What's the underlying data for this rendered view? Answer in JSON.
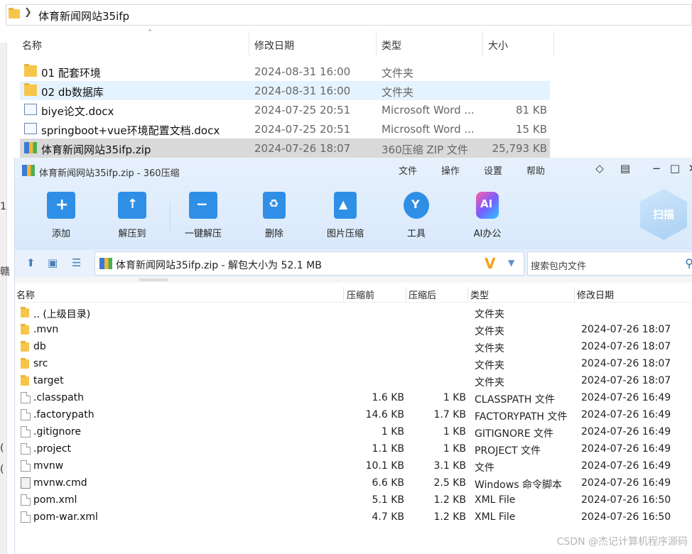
{
  "explorer": {
    "breadcrumb": "体育新闻网站35ifp",
    "columns": {
      "name": "名称",
      "modified": "修改日期",
      "type": "类型",
      "size": "大小"
    },
    "left_marks": [
      "1",
      "赣",
      "(",
      "("
    ],
    "rows": [
      {
        "name": "01 配套环境",
        "modified": "2024-08-31 16:00",
        "type": "文件夹",
        "size": "",
        "icon": "folder-icon"
      },
      {
        "name": "02 db数据库",
        "modified": "2024-08-31 16:00",
        "type": "文件夹",
        "size": "",
        "icon": "folder-icon"
      },
      {
        "name": "biye论文.docx",
        "modified": "2024-07-25 20:51",
        "type": "Microsoft Word ...",
        "size": "81 KB",
        "icon": "word-doc-icon"
      },
      {
        "name": "springboot+vue环境配置文档.docx",
        "modified": "2024-07-25 20:51",
        "type": "Microsoft Word ...",
        "size": "15 KB",
        "icon": "word-doc-icon"
      },
      {
        "name": "体育新闻网站35ifp.zip",
        "modified": "2024-07-26 18:07",
        "type": "360压缩 ZIP 文件",
        "size": "25,793 KB",
        "icon": "zip-archive-icon"
      }
    ]
  },
  "zip": {
    "window_title": "体育新闻网站35ifp.zip - 360压缩",
    "menu": [
      "文件",
      "操作",
      "设置",
      "帮助"
    ],
    "toolbar": [
      "添加",
      "解压到",
      "一键解压",
      "删除",
      "图片压缩",
      "工具",
      "AI办公"
    ],
    "scan_label": "扫描",
    "path": "体育新闻网站35ifp.zip - 解包大小为 52.1 MB",
    "search_placeholder": "搜索包内文件",
    "columns": {
      "name": "名称",
      "compressed_before": "压缩前",
      "compressed_after": "压缩后",
      "type": "类型",
      "modified": "修改日期"
    },
    "rows": [
      {
        "name": ".. (上级目录)",
        "before": "",
        "after": "",
        "type": "文件夹",
        "modified": "",
        "icon": "folder-icon"
      },
      {
        "name": ".mvn",
        "before": "",
        "after": "",
        "type": "文件夹",
        "modified": "2024-07-26 18:07",
        "icon": "folder-icon"
      },
      {
        "name": "db",
        "before": "",
        "after": "",
        "type": "文件夹",
        "modified": "2024-07-26 18:07",
        "icon": "folder-icon"
      },
      {
        "name": "src",
        "before": "",
        "after": "",
        "type": "文件夹",
        "modified": "2024-07-26 18:07",
        "icon": "folder-icon"
      },
      {
        "name": "target",
        "before": "",
        "after": "",
        "type": "文件夹",
        "modified": "2024-07-26 18:07",
        "icon": "folder-icon"
      },
      {
        "name": ".classpath",
        "before": "1.6 KB",
        "after": "1 KB",
        "type": "CLASSPATH 文件",
        "modified": "2024-07-26 16:49",
        "icon": "file-icon"
      },
      {
        "name": ".factorypath",
        "before": "14.6 KB",
        "after": "1.7 KB",
        "type": "FACTORYPATH 文件",
        "modified": "2024-07-26 16:49",
        "icon": "file-icon"
      },
      {
        "name": ".gitignore",
        "before": "1 KB",
        "after": "1 KB",
        "type": "GITIGNORE 文件",
        "modified": "2024-07-26 16:49",
        "icon": "file-icon"
      },
      {
        "name": ".project",
        "before": "1.1 KB",
        "after": "1 KB",
        "type": "PROJECT 文件",
        "modified": "2024-07-26 16:49",
        "icon": "file-icon"
      },
      {
        "name": "mvnw",
        "before": "10.1 KB",
        "after": "3.1 KB",
        "type": "文件",
        "modified": "2024-07-26 16:49",
        "icon": "file-icon"
      },
      {
        "name": "mvnw.cmd",
        "before": "6.6 KB",
        "after": "2.5 KB",
        "type": "Windows 命令脚本",
        "modified": "2024-07-26 16:49",
        "icon": "cmd-script-icon"
      },
      {
        "name": "pom.xml",
        "before": "5.1 KB",
        "after": "1.2 KB",
        "type": "XML File",
        "modified": "2024-07-26 16:50",
        "icon": "file-icon"
      },
      {
        "name": "pom-war.xml",
        "before": "4.7 KB",
        "after": "1.2 KB",
        "type": "XML File",
        "modified": "2024-07-26 16:50",
        "icon": "file-icon"
      }
    ]
  },
  "watermark": "CSDN @杰记计算机程序源码"
}
